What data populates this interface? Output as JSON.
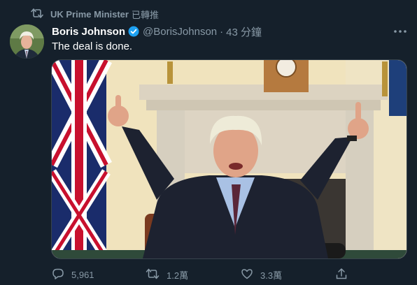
{
  "retweet_context": {
    "name": "UK Prime Minister",
    "suffix": "已轉推"
  },
  "author": {
    "name": "Boris Johnson",
    "handle": "@BorisJohnson",
    "separator": "·",
    "time": "43 分鐘"
  },
  "tweet": {
    "text": "The deal is done."
  },
  "actions": {
    "replies": "5,961",
    "retweets": "1.2萬",
    "likes": "3.3萬"
  },
  "colors": {
    "background": "#15202b",
    "secondary_text": "#8899a6",
    "verified": "#1da1f2",
    "border": "#38444d"
  },
  "icons": [
    "retweet-icon",
    "verified-badge-icon",
    "more-icon",
    "reply-icon",
    "like-icon",
    "share-icon"
  ]
}
